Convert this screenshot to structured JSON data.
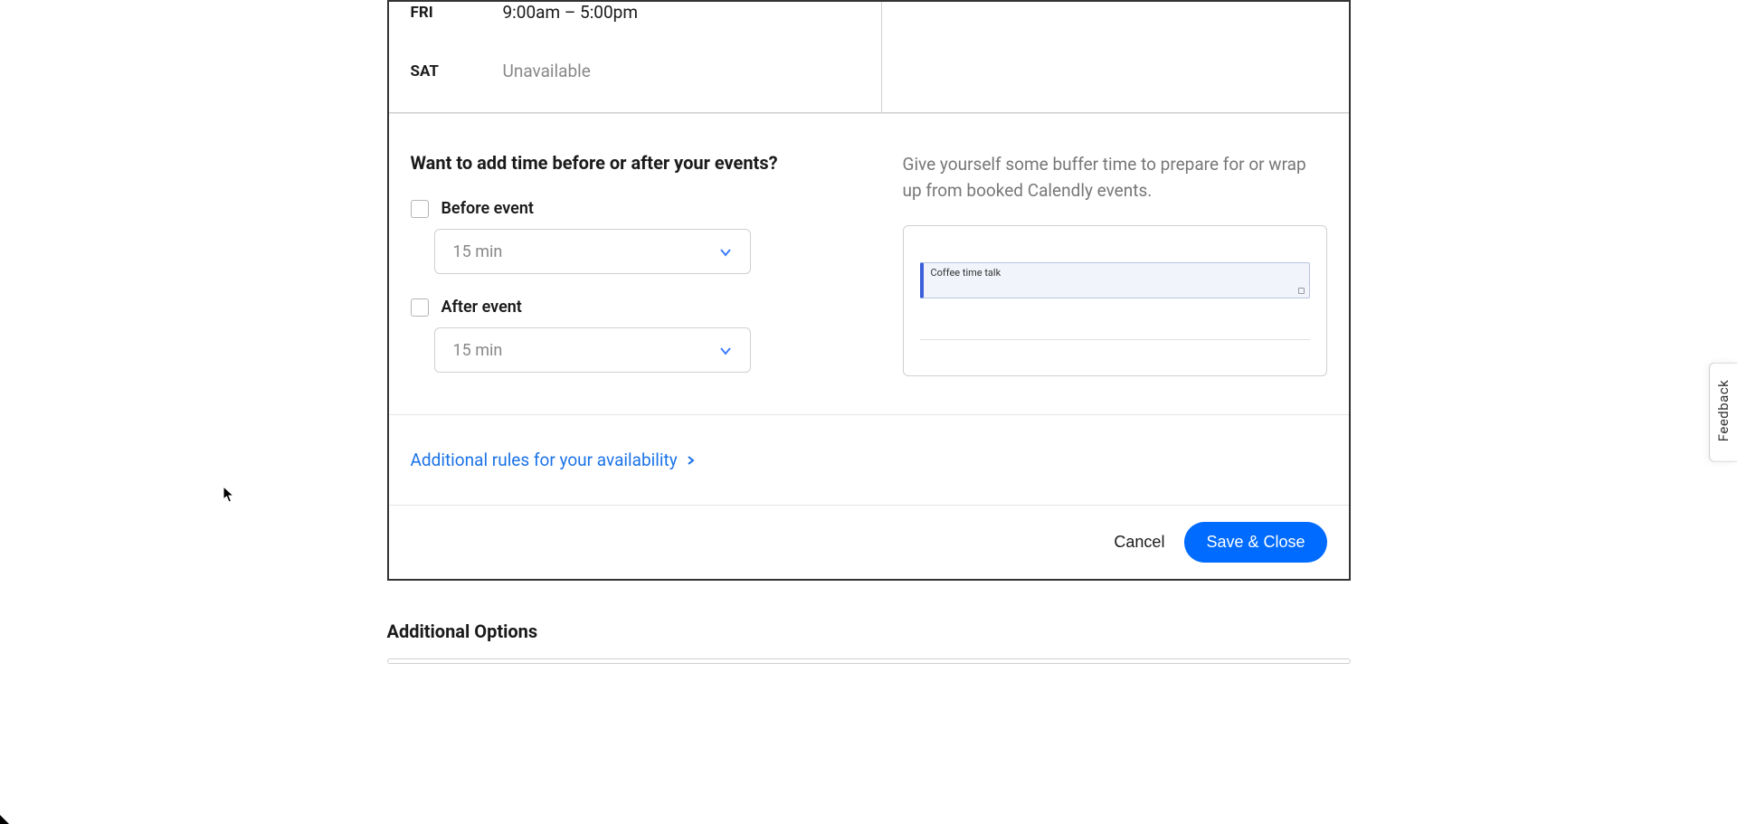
{
  "availability": {
    "rows": [
      {
        "day": "FRI",
        "hours": "9:00am – 5:00pm",
        "unavailable": false
      },
      {
        "day": "SAT",
        "hours": "Unavailable",
        "unavailable": true
      }
    ]
  },
  "buffer": {
    "heading": "Want to add time before or after your events?",
    "before_label": "Before event",
    "after_label": "After event",
    "before_value": "15 min",
    "after_value": "15 min",
    "help_text": "Give yourself some buffer time to prepare for or wrap up from booked Calendly events.",
    "preview_event_title": "Coffee time talk"
  },
  "additional_rules_label": "Additional rules for your availability",
  "footer": {
    "cancel": "Cancel",
    "save": "Save & Close"
  },
  "additional_options_heading": "Additional Options",
  "feedback_label": "Feedback"
}
